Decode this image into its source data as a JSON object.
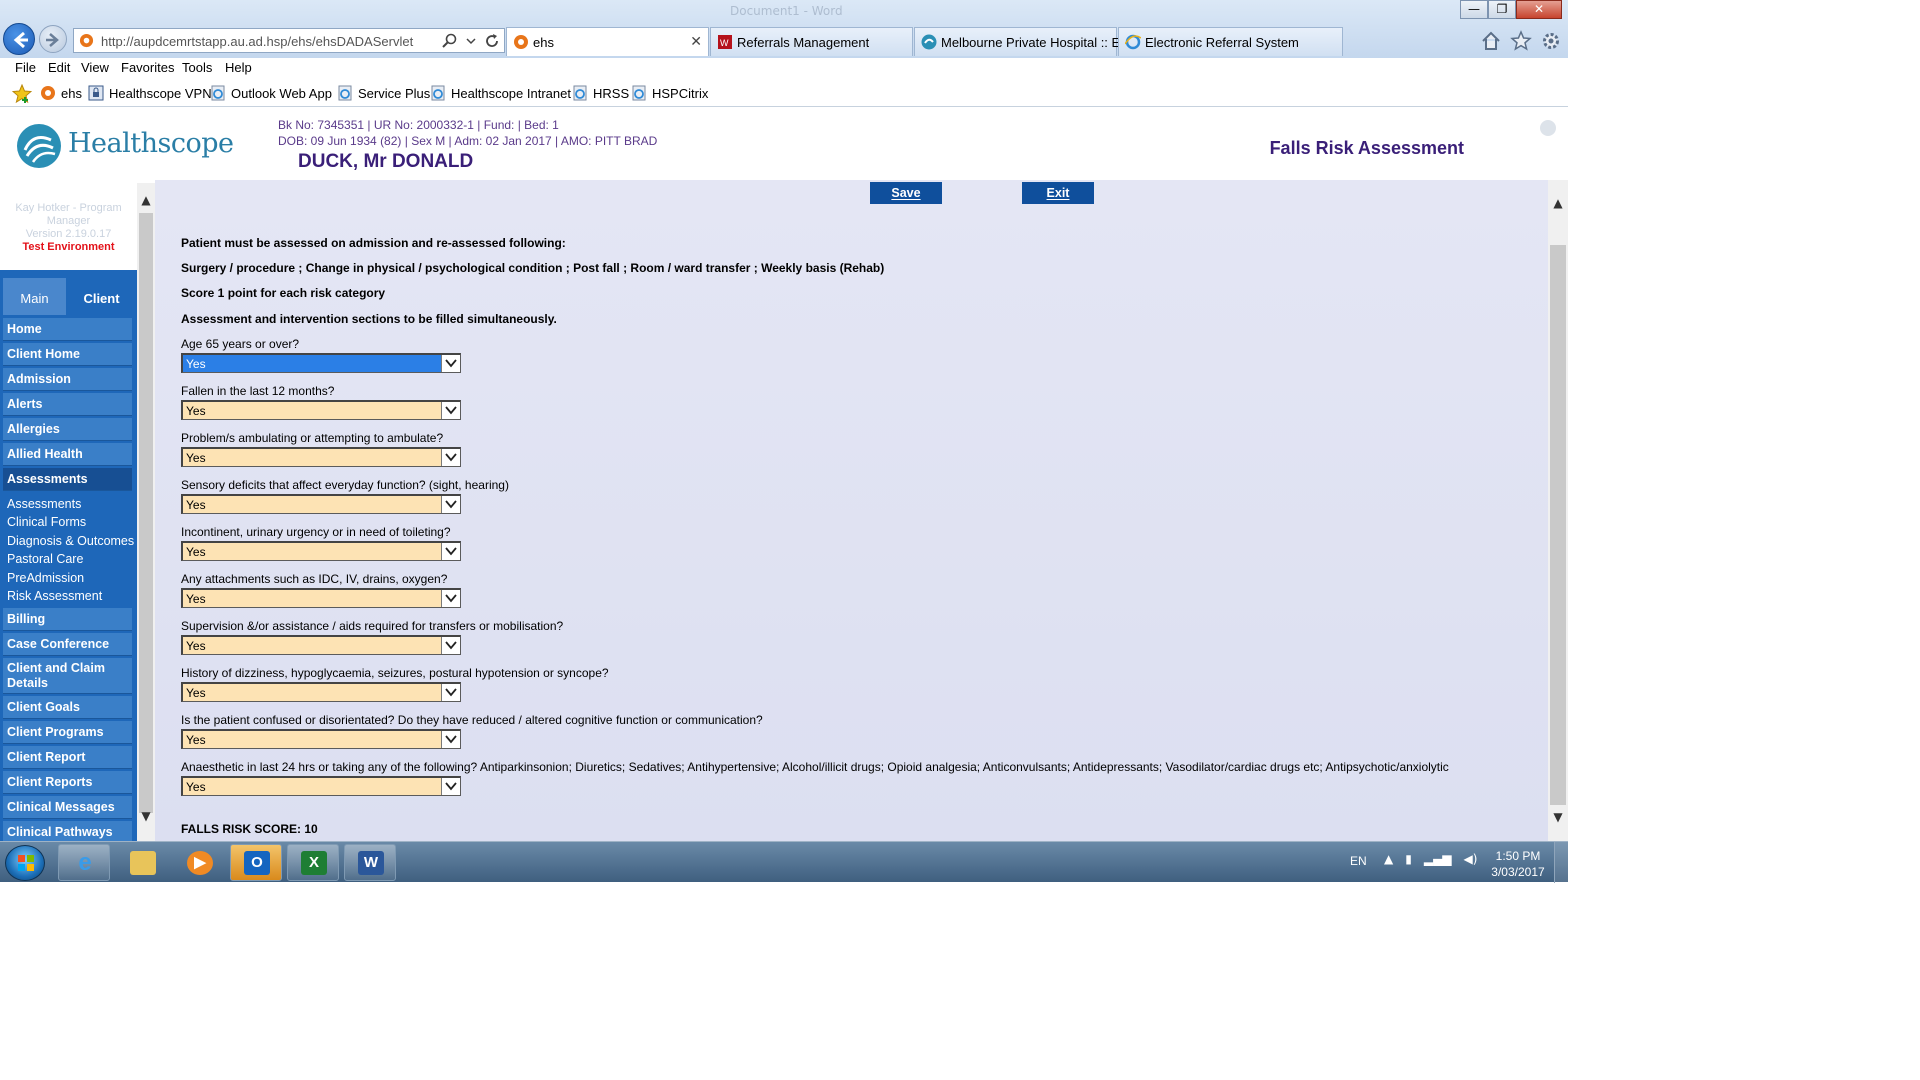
{
  "browser": {
    "window_title": "Document1 - Word",
    "address": "http://aupdcemrtstapp.au.ad.hsp/ehs/ehsDADAServlet",
    "tabs": [
      {
        "label": "ehs",
        "active": true
      },
      {
        "label": "Referrals Management"
      },
      {
        "label": "Melbourne Private Hospital :: E..."
      },
      {
        "label": "Electronic Referral System"
      }
    ],
    "menu": [
      "File",
      "Edit",
      "View",
      "Favorites",
      "Tools",
      "Help"
    ],
    "favorites": [
      "ehs",
      "Healthscope VPN",
      "Outlook Web App",
      "Service Plus",
      "Healthscope Intranet",
      "HRSS",
      "HSPCitrix"
    ]
  },
  "header": {
    "logo": "Healthscope",
    "patient_line1": "Bk No: 7345351 | UR No: 2000332-1 | Fund: | Bed: 1",
    "patient_line2": "DOB: 09 Jun 1934 (82) | Sex M | Adm: 02 Jan 2017 | AMO: PITT BRAD",
    "patient_name": "DUCK, Mr DONALD",
    "page_title": "Falls Risk Assessment"
  },
  "sidebar": {
    "user_name": "Kay Hotker - Program Manager",
    "version": "Version 2.19.0.17",
    "environment": "Test Environment",
    "tab_main": "Main",
    "tab_client": "Client",
    "items_top": [
      "Home",
      "Client Home",
      "Admission",
      "Alerts",
      "Allergies",
      "Allied Health"
    ],
    "active_item": "Assessments",
    "sub_items": [
      "Assessments",
      "Clinical Forms",
      "Diagnosis & Outcomes",
      "Pastoral Care",
      "PreAdmission",
      "Risk Assessment"
    ],
    "items_bottom": [
      "Billing",
      "Case Conference",
      "Client and Claim Details",
      "Client Goals",
      "Client Programs",
      "Client Report",
      "Client Reports",
      "Clinical Messages",
      "Clinical Pathways"
    ]
  },
  "form": {
    "save_label": "Save",
    "exit_label": "Exit",
    "instructions": [
      "Patient must be assessed on admission and re-assessed following:",
      "Surgery / procedure ; Change in physical / psychological condition ; Post fall ; Room / ward transfer ; Weekly basis (Rehab)",
      "Score 1 point for each risk category",
      "Assessment and intervention sections to be filled simultaneously."
    ],
    "questions": [
      {
        "label": "Age 65 years or over?",
        "value": "Yes"
      },
      {
        "label": "Fallen in the last 12 months?",
        "value": "Yes"
      },
      {
        "label": "Problem/s ambulating or attempting to ambulate?",
        "value": "Yes"
      },
      {
        "label": "Sensory deficits that affect everyday function? (sight, hearing)",
        "value": "Yes"
      },
      {
        "label": "Incontinent, urinary urgency or in need of toileting?",
        "value": "Yes"
      },
      {
        "label": "Any attachments such as IDC, IV, drains, oxygen?",
        "value": "Yes"
      },
      {
        "label": "Supervision &/or assistance / aids required for transfers or mobilisation?",
        "value": "Yes"
      },
      {
        "label": "History of dizziness, hypoglycaemia, seizures, postural hypotension or syncope?",
        "value": "Yes"
      },
      {
        "label": "Is the patient confused or disorientated? Do they have reduced / altered cognitive function or communication?",
        "value": "Yes"
      },
      {
        "label": "Anaesthetic in last 24 hrs or taking any of the following? Antiparkinsonion; Diuretics; Sedatives; Antihypertensive; Alcohol/illicit drugs; Opioid analgesia; Anticonvulsants; Antidepressants; Vasodilator/cardiac drugs etc; Antipsychotic/anxiolytic",
        "value": "Yes"
      }
    ],
    "score_label": "FALLS RISK SCORE: 10"
  },
  "taskbar": {
    "language": "EN",
    "time": "1:50 PM",
    "date": "3/03/2017"
  },
  "colors": {
    "nav_blue": "#3a7fc8",
    "nav_active": "#174f93",
    "button_blue": "#0f4f9c",
    "select_fill": "#fde3b4",
    "select_focus": "#2b7fe6",
    "heading_purple": "#3a1f78",
    "env_red": "#e3121a"
  }
}
